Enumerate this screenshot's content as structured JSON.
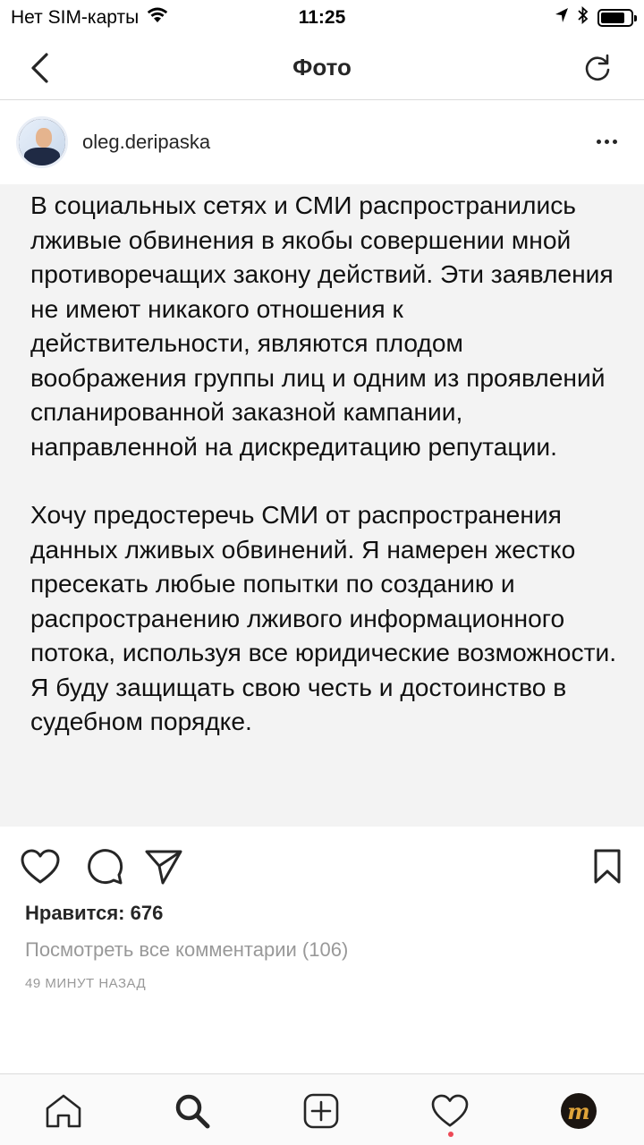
{
  "status_bar": {
    "carrier": "Нет SIM-карты",
    "time": "11:25"
  },
  "nav": {
    "title": "Фото"
  },
  "post": {
    "username": "oleg.deripaska",
    "paragraphs": [
      "В социальных сетях и СМИ распространились лживые обвинения в якобы совершении мной противоречащих закону действий. Эти заявления не имеют никакого отношения к действительности, являются плодом воображения группы лиц и одним из проявлений спланированной заказной кампании, направленной на дискредитацию репутации.",
      "Хочу предостеречь СМИ от распространения данных лживых обвинений. Я намерен жестко пресекать любые попытки по созданию и распространению лживого информационного потока, используя все юридические возможности. Я буду защищать свою честь и достоинство в судебном порядке."
    ],
    "likes_label": "Нравится: 676",
    "view_comments": "Посмотреть все комментарии (106)",
    "timestamp": "49 МИНУТ НАЗАД"
  },
  "tab_bar": {
    "profile_letter": "m"
  },
  "colors": {
    "text": "#262626",
    "muted": "#999999",
    "notification": "#ed4956"
  }
}
